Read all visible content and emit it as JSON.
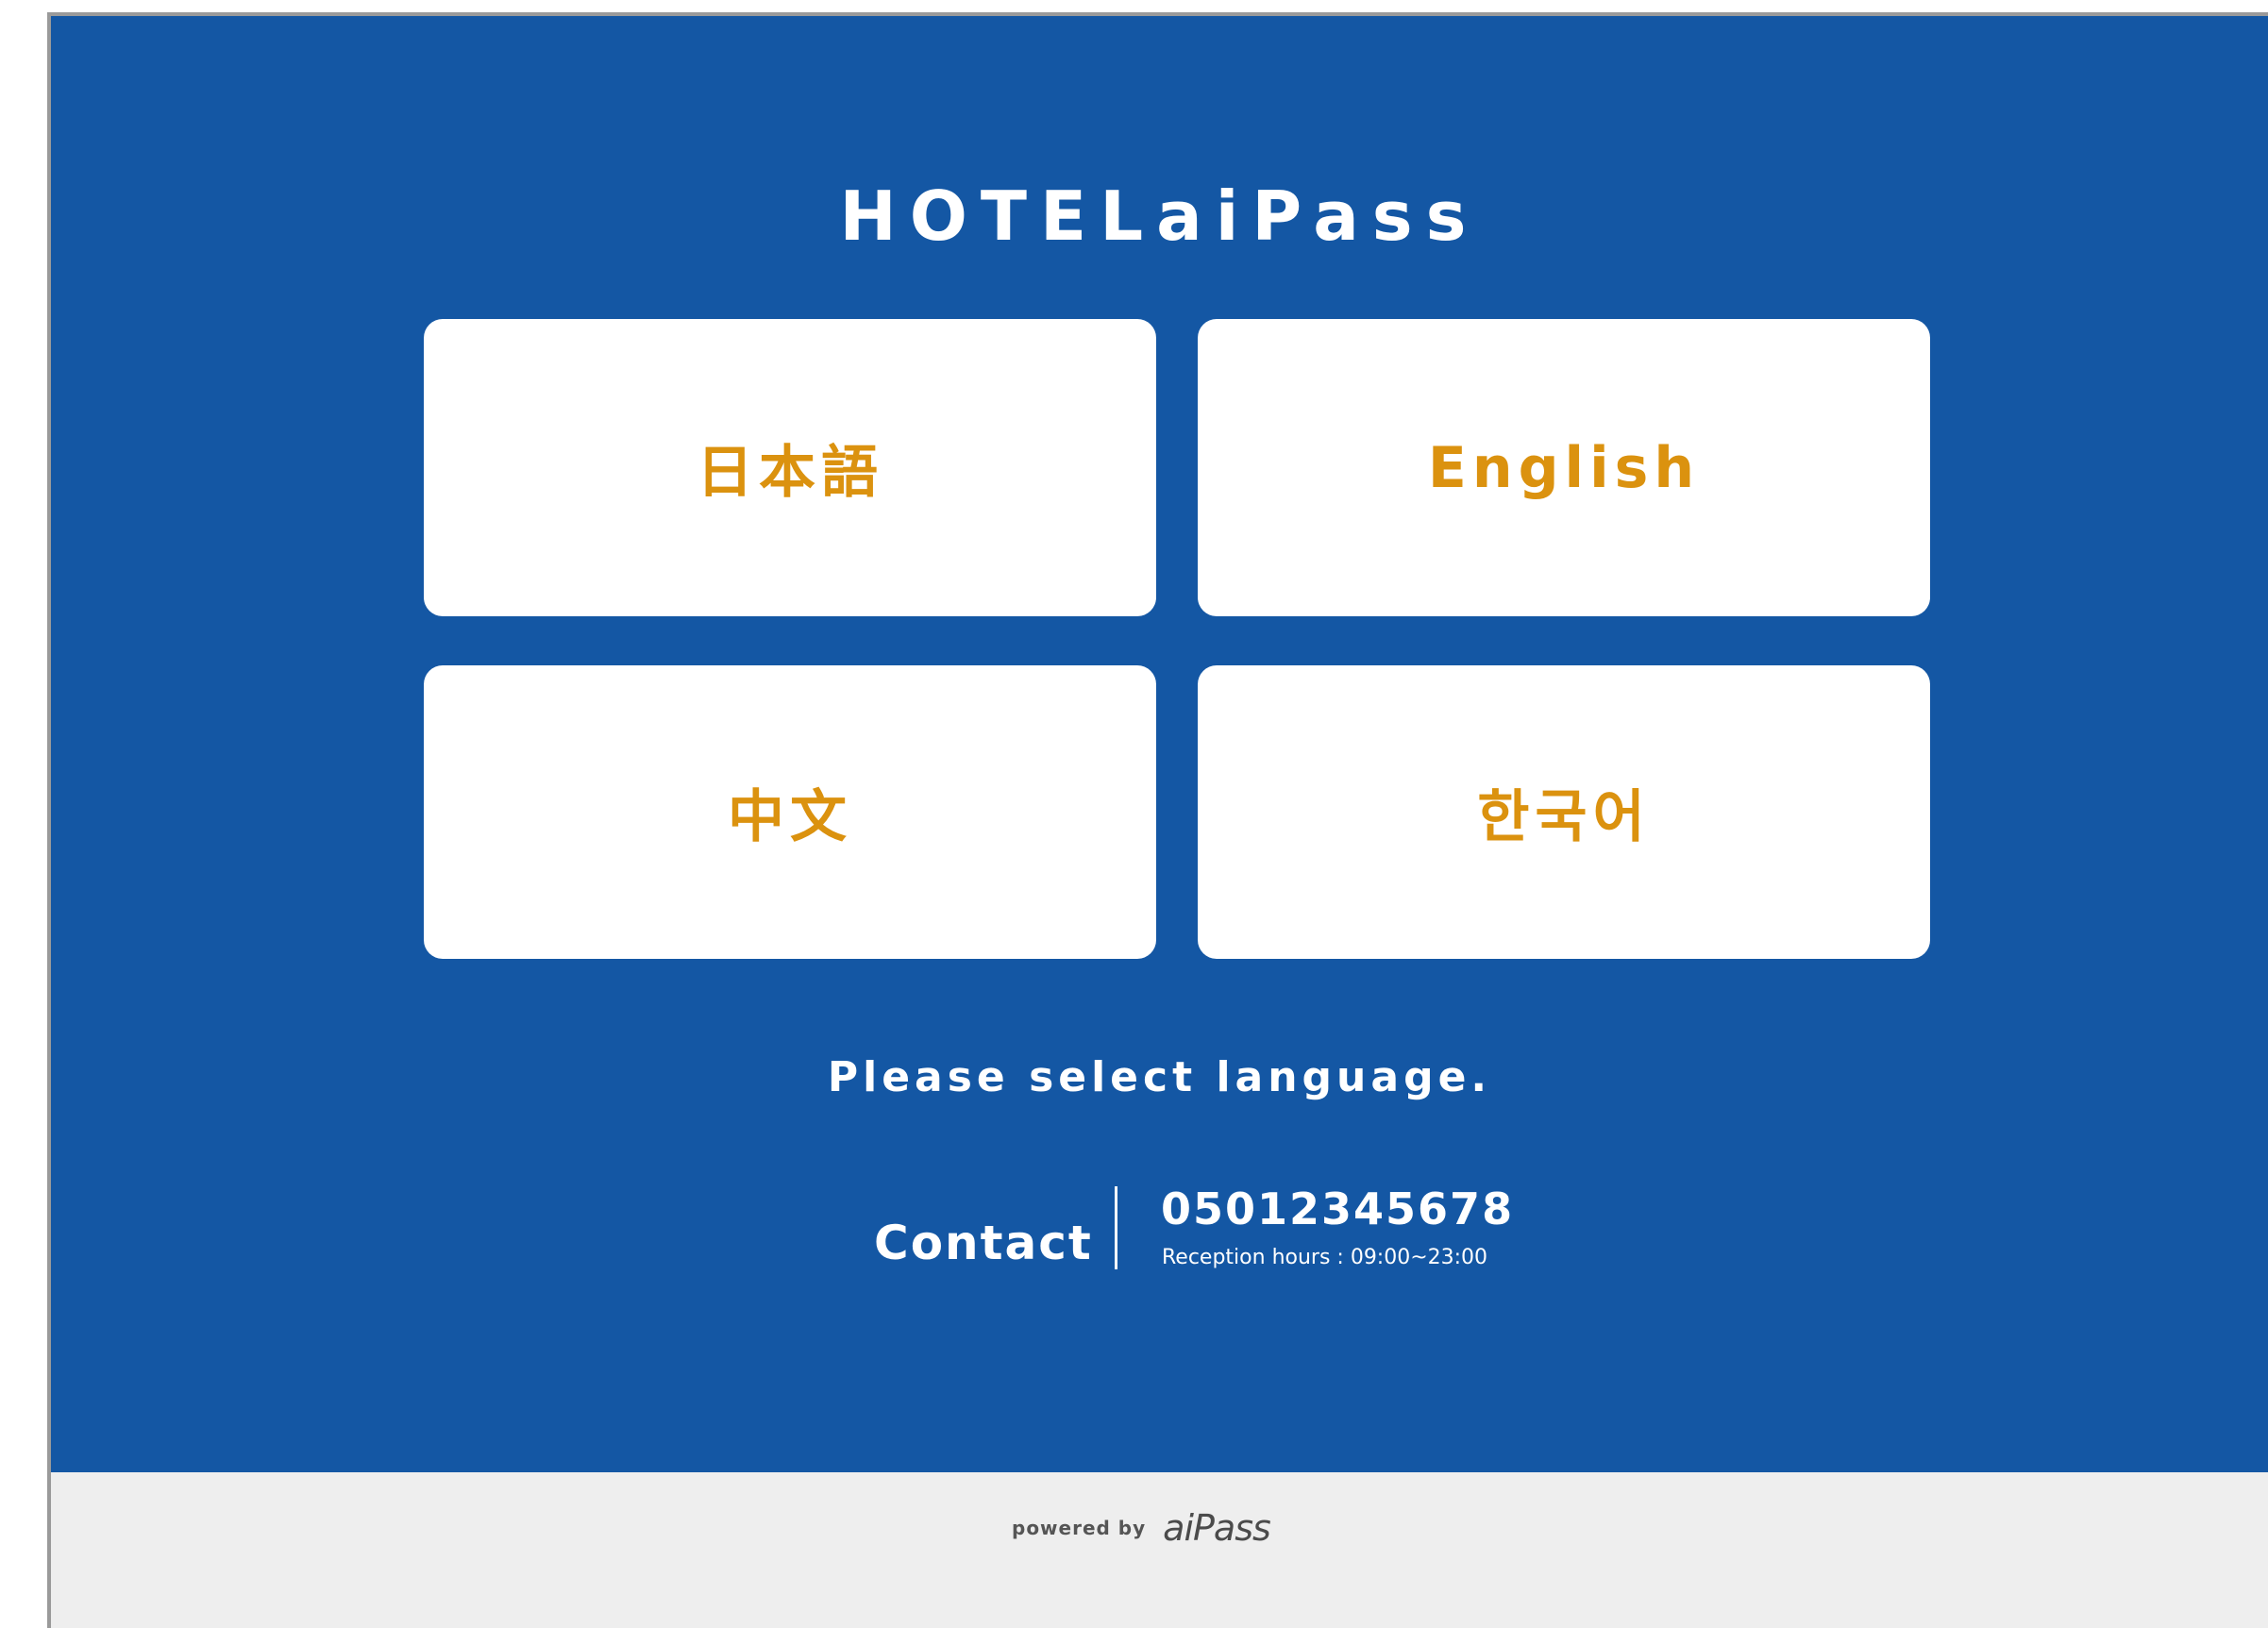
{
  "app": {
    "title": "HOTELaiPass"
  },
  "languages": [
    {
      "label": "日本語",
      "code": "ja"
    },
    {
      "label": "English",
      "code": "en"
    },
    {
      "label": "中文",
      "code": "zh"
    },
    {
      "label": "한국어",
      "code": "ko"
    }
  ],
  "prompt": "Please select language.",
  "contact": {
    "label": "Contact",
    "phone": "05012345678",
    "hours": "Reception hours : 09:00~23:00"
  },
  "footer": {
    "powered_by": "powered by",
    "brand": "aiPass"
  },
  "colors": {
    "primary_blue": "#1457a4",
    "accent_orange": "#db920f",
    "footer_gray": "#eeeeee",
    "white": "#ffffff"
  }
}
